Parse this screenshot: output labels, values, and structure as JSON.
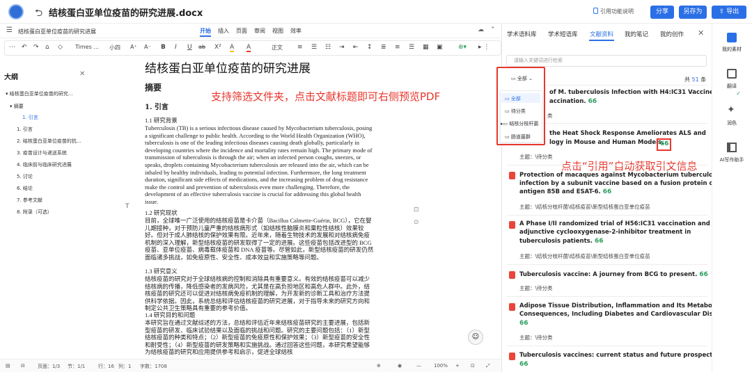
{
  "header": {
    "doc_title": "结核蛋白亚单位疫苗的研究进展.docx",
    "cite_help": "引用功能说明",
    "share": "分享",
    "save_as": "另存为",
    "export": "导出"
  },
  "menubar": {
    "doc_name": "结核蛋白亚单位疫苗的研究进展",
    "tabs": [
      "开始",
      "插入",
      "页面",
      "审阅",
      "视图",
      "效率"
    ],
    "active_tab": "开始"
  },
  "format_toolbar": {
    "font_name": "Times ...",
    "font_size": "小四",
    "para_style": "正文",
    "buttons": [
      "B",
      "I",
      "U",
      "ab",
      "A",
      "A"
    ]
  },
  "outline": {
    "title": "大纲",
    "items": [
      "结核蛋白亚单位疫苗的研究...",
      "摘要",
      "1. 引言",
      "1. 引言",
      "2. 结核蛋白亚单位疫苗的抗...",
      "3. 疫苗设计与递送系统",
      "4. 临床前与临床研究进展",
      "5. 讨论",
      "6. 结论",
      "7. 参考文献",
      "8. 附录（可选）"
    ]
  },
  "document": {
    "title": "结核蛋白亚单位疫苗的研究进展",
    "abstract_heading": "摘要",
    "section1_heading": "1.  引言",
    "p_bg_title": "1.1 研究背景",
    "p_bg": "Tuberculosis (TB) is a serious infectious disease caused by Mycobacterium tuberculosis, posing a significant challenge to public health. According to the World Health Organization (WHO), tuberculosis is one of the leading infectious diseases causing death globally, particularly in developing countries where the incidence and mortality rates remain high. The primary mode of transmission of tuberculosis is through the air; when an infected person coughs, sneezes, or speaks, droplets containing Mycobacterium tuberculosis are released into the air, which can be inhaled by healthy individuals, leading to potential infection. Furthermore, the long treatment duration, significant side effects of medications, and the increasing problem of drug resistance make the control and prevention of tuberculosis even more challenging. Therefore, the development of an effective tuberculosis vaccine is crucial for addressing this global health issue.",
    "p_status_title": "1.2 研究现状",
    "p_status": "目前，全球唯一广泛使用的结核疫苗是卡介苗（Bacillus Calmette-Guérin, BCG），它在婴儿期接种，对于预防儿童严重的结核病形式（如结核性脑膜炎和粟粒性结核）效果较好。但对于成人肺结核的保护效果有限。近年来，随着生物技术的发展和对结核病免疫机制的深入理解，新型结核疫苗的研发取得了一定的进展。这些疫苗包括改进型的 BCG 疫苗、亚单位疫苗、病毒载体疫苗和 DNA 疫苗等。尽管如此，新型结核疫苗的研发仍然面临诸多挑战，如免疫原性、安全性、成本效益和实施策略等问题。",
    "p_sig_title": "1.3 研究意义",
    "p_sig": "结核疫苗的研究对于全球结核病的控制和消除具有重要意义。有效的结核疫苗可以减少结核病的传播，降低感染者的发病风险，尤其是在高负担地区和高危人群中。此外，结核疫苗的研究还可以促进对结核病免疫机制的理解，为开发新的诊断工具和治疗方法提供科学依据。因此，系统总结和评估结核疫苗的研究进展，对于指导未来的研究方向和制定公共卫生策略具有重要的参考价值。",
    "p_q_title": "1.4 研究目的和问题",
    "p_q": "本研究旨在通过文献综述的方法，总结和评估近年来结核疫苗研究的主要进展，包括新型疫苗的研发、临床试验结果以及面临的挑战和问题。研究的主要问题包括：（1）新型结核疫苗的种类和特点；（2）新型疫苗的免疫原性和保护效果；（3）新型疫苗的安全性和耐受性；（4）新型疫苗的研发策略和实施挑战。通过回答这些问题，本研究希望能够为结核疫苗的研究和应用提供参考和启示，促进全球结核"
  },
  "annotations": {
    "note1": "支持筛选文件夹，点击文献标题即可右侧预览PDF",
    "note2": "点击“引用”自动获取引文信息"
  },
  "statusbar": {
    "page": "页面：1/3",
    "section": "节：1/1",
    "row": "行：16",
    "col": "列：1",
    "words": "字数：1708",
    "zoom": "100%"
  },
  "right_panel": {
    "tabs": [
      "学术语料库",
      "学术短语库",
      "文献资料",
      "我的笔记",
      "我的创作"
    ],
    "active_tab": "文献资料",
    "search_placeholder": "请输入关键词进行检索",
    "filter_selected": "全部",
    "count_prefix": "共",
    "count_num": "51",
    "count_suffix": "条",
    "folders": [
      "全部",
      "待分类",
      "结核分枝杆菌",
      "肠道菌群"
    ],
    "items": [
      {
        "title": "of M. tuberculosis Infection with H4:IC31 Vaccine",
        "title2": "accination.",
        "meta": "类"
      },
      {
        "title": "the Heat Shock Response Ameliorates ALS and",
        "title2": "logy in Mouse and Human Models.",
        "meta": "主题：\\待分类"
      },
      {
        "title": "Protection of macaques against Mycobacterium tuberculosis",
        "title2": "infection by a subunit vaccine based on a fusion protein of",
        "title3": "antigen 85B and ESAT-6.",
        "meta": "主题：\\结核分枝杆菌\\结核疫苗\\新型结核蛋白亚单位疫苗"
      },
      {
        "title": "A Phase I/II randomized trial of H56:IC31 vaccination and",
        "title2": "adjunctive cyclooxygenase-2-inhibitor treatment in",
        "title3": "tuberculosis patients.",
        "meta": "主题：\\结核分枝杆菌\\结核疫苗\\新型结核蛋白亚单位疫苗"
      },
      {
        "title": "Tuberculosis vaccine: A journey from BCG to present.",
        "meta": "主题：\\待分类"
      },
      {
        "title": "Adipose Tissue Distribution, Inflammation and Its Metabolic",
        "title2": "Consequences, Including Diabetes and Cardiovascular Disease.",
        "meta": "主题：\\待分类"
      },
      {
        "title": "Tuberculosis vaccines: current status and future prospects.",
        "meta": ""
      }
    ],
    "cite_glyph": "66"
  },
  "far_sidebar": {
    "items": [
      "我的素材",
      "翻译",
      "润色",
      "AI写作助手"
    ]
  },
  "colors": {
    "accent": "#2b6fe6",
    "annotation": "#e8362c",
    "pdf": "#e9453a",
    "cite": "#2a9d5c"
  }
}
